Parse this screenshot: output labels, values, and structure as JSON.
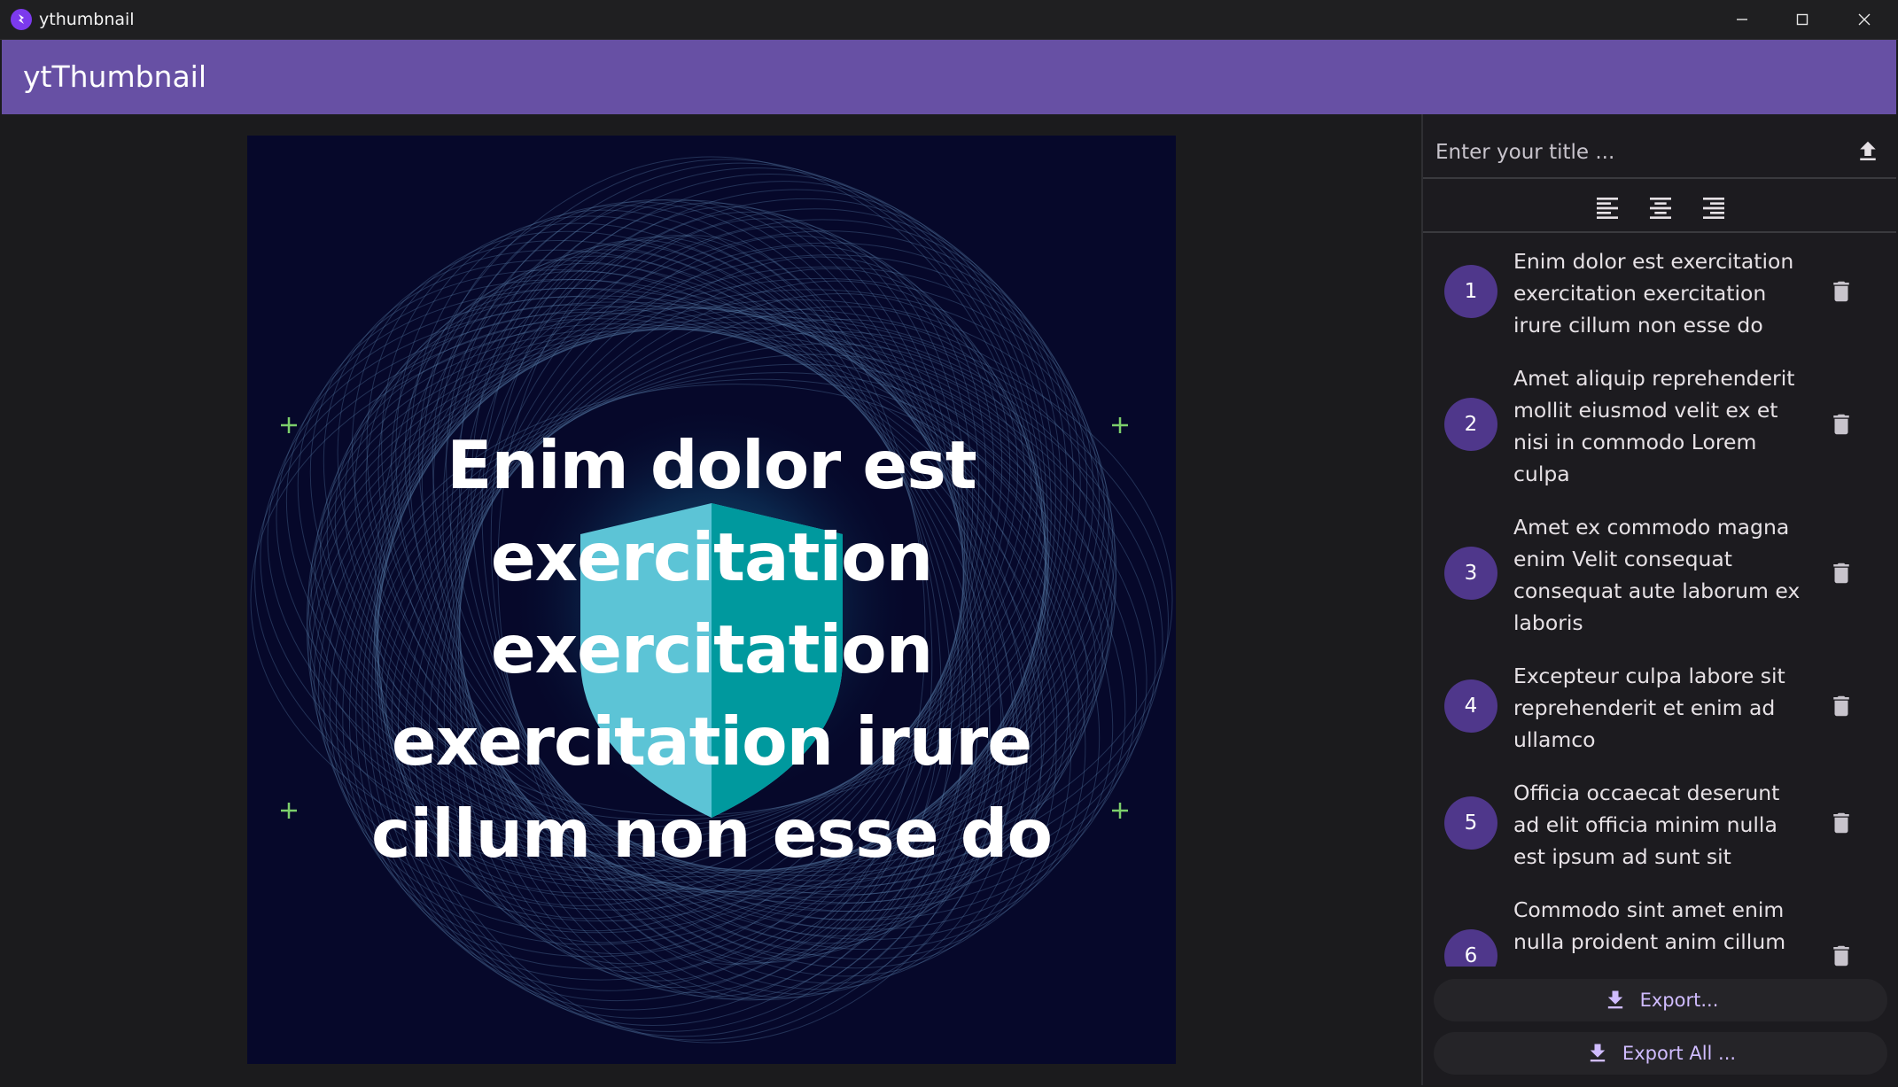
{
  "window": {
    "title": "ythumbnail",
    "icon": "app-logo-icon"
  },
  "appbar": {
    "title": "ytThumbnail",
    "color": "#6750a4"
  },
  "thumbnail": {
    "headline": "Enim dolor est exercitation exercitation exercitation irure cillum non esse do",
    "background": "#06082a",
    "pattern_color": "#5a7fa8",
    "shield_color": "#1aa5ad"
  },
  "sidebar": {
    "title_input": {
      "placeholder": "Enter your title ...",
      "value": ""
    },
    "upload_icon": "upload-icon",
    "align_buttons": [
      "align-left-icon",
      "align-center-icon",
      "align-right-icon"
    ],
    "items": [
      {
        "number": "1",
        "text": "Enim dolor est exercitation exercitation exercitation irure cillum non esse do"
      },
      {
        "number": "2",
        "text": "Amet aliquip reprehenderit mollit eiusmod velit ex et nisi in commodo Lorem culpa"
      },
      {
        "number": "3",
        "text": "Amet ex commodo magna enim Velit consequat consequat aute laborum ex laboris"
      },
      {
        "number": "4",
        "text": "Excepteur culpa labore sit reprehenderit et enim ad ullamco"
      },
      {
        "number": "5",
        "text": "Officia occaecat deserunt ad elit officia minim nulla est ipsum ad sunt sit"
      },
      {
        "number": "6",
        "text": "Commodo sint amet enim nulla proident anim cillum"
      }
    ],
    "export_label": "Export...",
    "export_all_label": "Export All ..."
  },
  "colors": {
    "accent": "#6750a4",
    "badge": "#4f378b",
    "button_text": "#d0bcff"
  }
}
